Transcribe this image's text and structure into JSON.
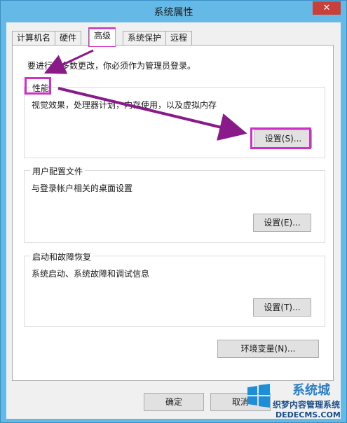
{
  "window": {
    "title": "系统属性",
    "close_glyph": "✕"
  },
  "tabs": [
    {
      "label": "计算机名",
      "active": false
    },
    {
      "label": "硬件",
      "active": false
    },
    {
      "label": "高级",
      "active": true
    },
    {
      "label": "系统保护",
      "active": false
    },
    {
      "label": "远程",
      "active": false
    }
  ],
  "notice": "要进行大多数更改，你必须作为管理员登录。",
  "groups": {
    "performance": {
      "title": "性能",
      "description": "视觉效果，处理器计划，内存使用，以及虚拟内存",
      "button": "设置(S)..."
    },
    "user_profiles": {
      "title": "用户配置文件",
      "description": "与登录帐户相关的桌面设置",
      "button": "设置(E)..."
    },
    "startup_recovery": {
      "title": "启动和故障恢复",
      "description": "系统启动、系统故障和调试信息",
      "button": "设置(T)..."
    }
  },
  "env_button": "环境变量(N)...",
  "footer": {
    "ok": "确定",
    "cancel": "取消"
  },
  "annotation_color": "#d030c8",
  "arrow_color": "#8a1a8a",
  "watermark": {
    "line1": "织梦内容管理系统",
    "line2": "DEDECMS.COM",
    "brand": "系统城"
  }
}
